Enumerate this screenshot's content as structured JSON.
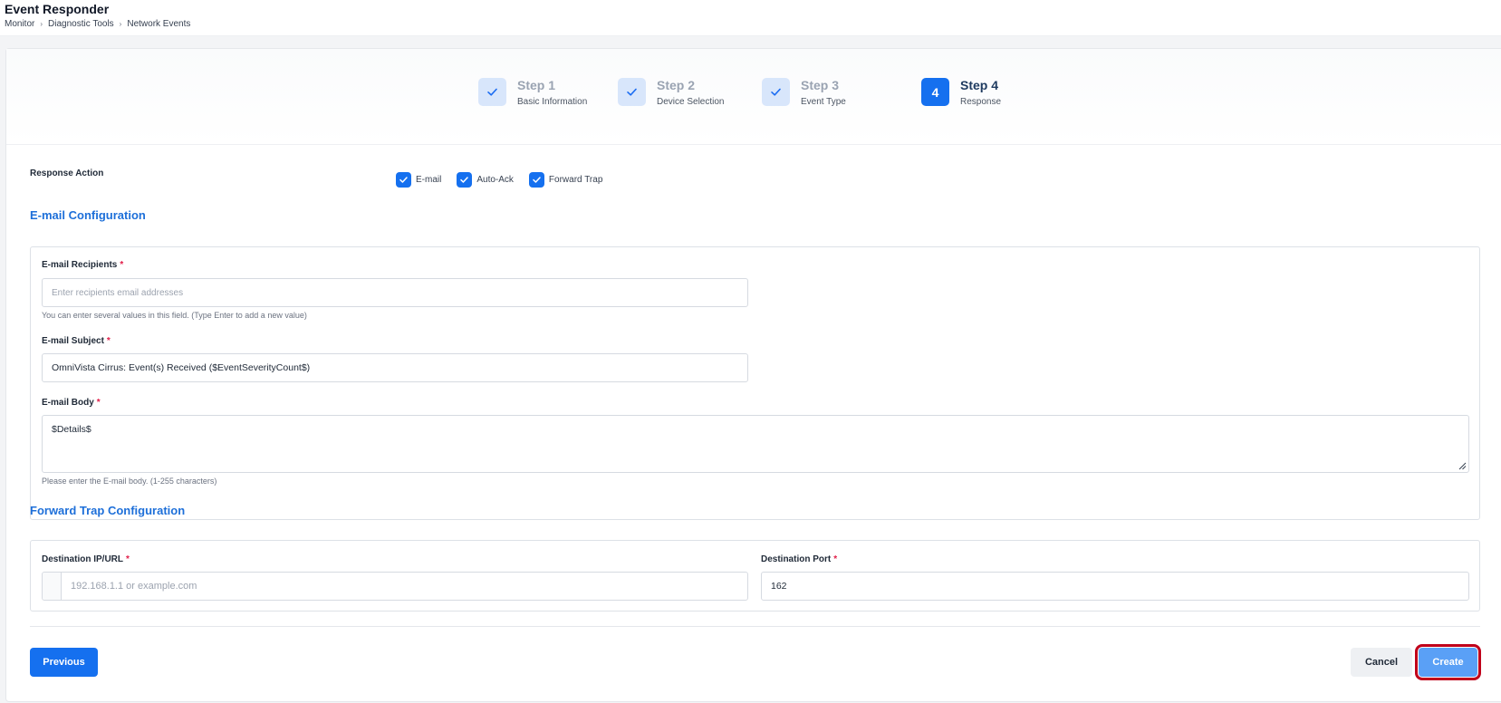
{
  "header": {
    "title": "Event Responder",
    "breadcrumb": [
      "Monitor",
      "Diagnostic Tools",
      "Network Events"
    ],
    "separator": "›"
  },
  "steps": [
    {
      "title": "Step 1",
      "subtitle": "Basic Information",
      "state": "done"
    },
    {
      "title": "Step 2",
      "subtitle": "Device Selection",
      "state": "done"
    },
    {
      "title": "Step 3",
      "subtitle": "Event Type",
      "state": "done"
    },
    {
      "title": "Step 4",
      "subtitle": "Response",
      "state": "active",
      "number": "4"
    }
  ],
  "response_action": {
    "label": "Response Action",
    "options": [
      {
        "label": "E-mail",
        "checked": true
      },
      {
        "label": "Auto-Ack",
        "checked": true
      },
      {
        "label": "Forward Trap",
        "checked": true
      }
    ]
  },
  "email_config": {
    "section_title": "E-mail Configuration",
    "recipients": {
      "label": "E-mail Recipients",
      "required": "*",
      "placeholder": "Enter recipients email addresses",
      "helper": "You can enter several values in this field. (Type Enter to add a new value)"
    },
    "subject": {
      "label": "E-mail Subject",
      "required": "*",
      "value": "OmniVista Cirrus: Event(s) Received ($EventSeverityCount$)"
    },
    "body": {
      "label": "E-mail Body",
      "required": "*",
      "value": "$Details$",
      "helper": "Please enter the E-mail body. (1-255 characters)"
    }
  },
  "trap_config": {
    "section_title": "Forward Trap Configuration",
    "destination_ip": {
      "label": "Destination IP/URL",
      "required": "*",
      "placeholder": "192.168.1.1 or example.com"
    },
    "destination_port": {
      "label": "Destination Port",
      "required": "*",
      "value": "162"
    }
  },
  "footer": {
    "previous_label": "Previous",
    "cancel_label": "Cancel",
    "create_label": "Create"
  },
  "colors": {
    "primary": "#1570ef",
    "section_title": "#1d6fd9",
    "required": "#e11d48",
    "highlight_outline": "#c0001a"
  },
  "icons": {
    "step_done": "check-icon",
    "checkbox": "check-icon",
    "resize": "resize-grip-icon"
  }
}
